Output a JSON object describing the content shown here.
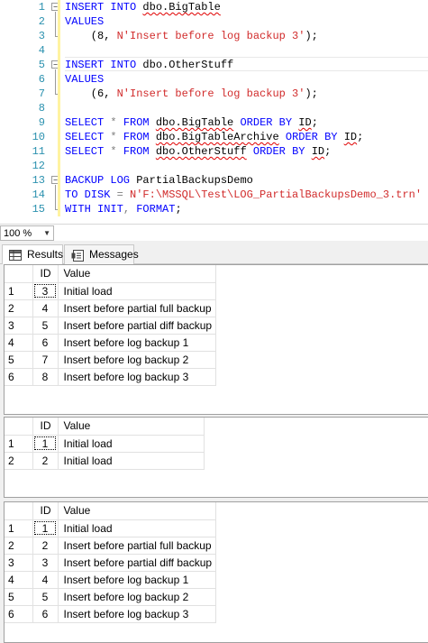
{
  "editor": {
    "lines": [
      {
        "n": "1",
        "t": [
          {
            "c": "kw",
            "s": "INSERT INTO "
          },
          {
            "c": "sq",
            "s": "dbo.BigTable"
          }
        ]
      },
      {
        "n": "2",
        "t": [
          {
            "c": "kw",
            "s": "VALUES"
          }
        ]
      },
      {
        "n": "3",
        "t": [
          {
            "c": "",
            "s": "    (8, "
          },
          {
            "c": "str",
            "s": "N'Insert before log backup 3'"
          },
          {
            "c": "",
            "s": ");"
          }
        ]
      },
      {
        "n": "4",
        "t": []
      },
      {
        "n": "5",
        "t": [
          {
            "c": "kw",
            "s": "INSERT INTO "
          },
          {
            "c": "",
            "s": "dbo.OtherStuff"
          }
        ]
      },
      {
        "n": "6",
        "t": [
          {
            "c": "kw",
            "s": "VALUES"
          }
        ]
      },
      {
        "n": "7",
        "t": [
          {
            "c": "",
            "s": "    (6, "
          },
          {
            "c": "str",
            "s": "N'Insert before log backup 3'"
          },
          {
            "c": "",
            "s": ");"
          }
        ]
      },
      {
        "n": "8",
        "t": []
      },
      {
        "n": "9",
        "t": [
          {
            "c": "kw",
            "s": "SELECT "
          },
          {
            "c": "op",
            "s": "* "
          },
          {
            "c": "kw",
            "s": "FROM "
          },
          {
            "c": "sq",
            "s": "dbo.BigTable"
          },
          {
            "c": "kw",
            "s": " ORDER BY "
          },
          {
            "c": "sq",
            "s": "ID"
          },
          {
            "c": "",
            "s": ";"
          }
        ]
      },
      {
        "n": "10",
        "t": [
          {
            "c": "kw",
            "s": "SELECT "
          },
          {
            "c": "op",
            "s": "* "
          },
          {
            "c": "kw",
            "s": "FROM "
          },
          {
            "c": "sq",
            "s": "dbo.BigTableArchive"
          },
          {
            "c": "kw",
            "s": " ORDER BY "
          },
          {
            "c": "sq",
            "s": "ID"
          },
          {
            "c": "",
            "s": ";"
          }
        ]
      },
      {
        "n": "11",
        "t": [
          {
            "c": "kw",
            "s": "SELECT "
          },
          {
            "c": "op",
            "s": "* "
          },
          {
            "c": "kw",
            "s": "FROM "
          },
          {
            "c": "sq",
            "s": "dbo.OtherStuff"
          },
          {
            "c": "kw",
            "s": " ORDER BY "
          },
          {
            "c": "sq",
            "s": "ID"
          },
          {
            "c": "",
            "s": ";"
          }
        ]
      },
      {
        "n": "12",
        "t": []
      },
      {
        "n": "13",
        "t": [
          {
            "c": "kw",
            "s": "BACKUP LOG "
          },
          {
            "c": "",
            "s": "PartialBackupsDemo"
          }
        ]
      },
      {
        "n": "14",
        "t": [
          {
            "c": "kw",
            "s": "TO DISK "
          },
          {
            "c": "op",
            "s": "= "
          },
          {
            "c": "str",
            "s": "N'F:\\MSSQL\\Test\\LOG_PartialBackupsDemo_3.trn'"
          }
        ]
      },
      {
        "n": "15",
        "t": [
          {
            "c": "kw",
            "s": "WITH INIT"
          },
          {
            "c": "op",
            "s": ", "
          },
          {
            "c": "kw",
            "s": "FORMAT"
          },
          {
            "c": "",
            "s": ";"
          }
        ]
      }
    ]
  },
  "zoom": {
    "value": "100 %",
    "arrow_icon": "chevron-down-icon"
  },
  "tabs": {
    "results": {
      "label": "Results",
      "icon": "grid-icon"
    },
    "messages": {
      "label": "Messages",
      "icon": "messages-icon"
    }
  },
  "grids": [
    {
      "headers": {
        "id": "ID",
        "value": "Value"
      },
      "rows": [
        {
          "n": "1",
          "id": "3",
          "value": "Initial load"
        },
        {
          "n": "2",
          "id": "4",
          "value": "Insert before partial full backup"
        },
        {
          "n": "3",
          "id": "5",
          "value": "Insert before partial diff backup"
        },
        {
          "n": "4",
          "id": "6",
          "value": "Insert before log backup 1"
        },
        {
          "n": "5",
          "id": "7",
          "value": "Insert before log backup 2"
        },
        {
          "n": "6",
          "id": "8",
          "value": "Insert before log backup 3"
        }
      ]
    },
    {
      "headers": {
        "id": "ID",
        "value": "Value"
      },
      "rows": [
        {
          "n": "1",
          "id": "1",
          "value": "Initial load"
        },
        {
          "n": "2",
          "id": "2",
          "value": "Initial load"
        }
      ]
    },
    {
      "headers": {
        "id": "ID",
        "value": "Value"
      },
      "rows": [
        {
          "n": "1",
          "id": "1",
          "value": "Initial load"
        },
        {
          "n": "2",
          "id": "2",
          "value": "Insert before partial full backup"
        },
        {
          "n": "3",
          "id": "3",
          "value": "Insert before partial diff backup"
        },
        {
          "n": "4",
          "id": "4",
          "value": "Insert before log backup 1"
        },
        {
          "n": "5",
          "id": "5",
          "value": "Insert before log backup 2"
        },
        {
          "n": "6",
          "id": "6",
          "value": "Insert before log backup 3"
        }
      ]
    }
  ]
}
